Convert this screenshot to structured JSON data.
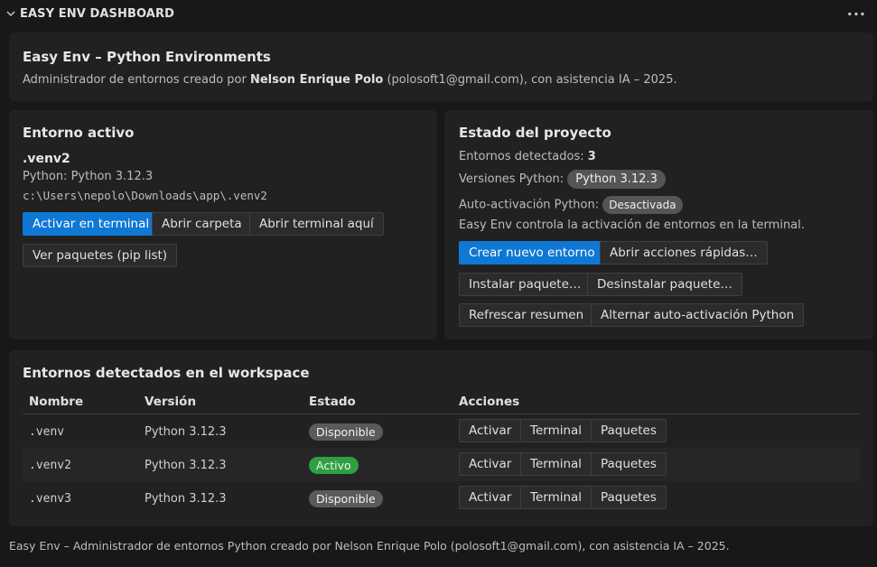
{
  "header": {
    "title": "EASY ENV DASHBOARD"
  },
  "intro": {
    "title": "Easy Env – Python Environments",
    "desc_prefix": "Administrador de entornos creado por ",
    "author": "Nelson Enrique Polo",
    "desc_suffix": " (polosoft1@gmail.com), con asistencia IA – 2025."
  },
  "active_env": {
    "heading": "Entorno activo",
    "name": ".venv2",
    "python": "Python: Python 3.12.3",
    "path": "c:\\Users\\nepolo\\Downloads\\app\\.venv2",
    "buttons": {
      "activate": "Activar en terminal",
      "open_folder": "Abrir carpeta",
      "open_terminal": "Abrir terminal aquí",
      "packages": "Ver paquetes (pip list)"
    }
  },
  "project": {
    "heading": "Estado del proyecto",
    "detected_label": "Entornos detectados: ",
    "detected_count": "3",
    "versions_label": "Versiones Python:",
    "version_pill": "Python 3.12.3",
    "autoact_label": "Auto-activación Python:",
    "autoact_state": "Desactivada",
    "note": "Easy Env controla la activación de entornos en la terminal.",
    "buttons": {
      "create": "Crear nuevo entorno",
      "quick": "Abrir acciones rápidas…",
      "install": "Instalar paquete…",
      "uninstall": "Desinstalar paquete…",
      "refresh": "Refrescar resumen",
      "toggle": "Alternar auto-activación Python"
    }
  },
  "workspace": {
    "heading": "Entornos detectados en el workspace",
    "columns": [
      "Nombre",
      "Versión",
      "Estado",
      "Acciones"
    ],
    "rows": [
      {
        "name": ".venv",
        "version": "Python 3.12.3",
        "status": "Disponible"
      },
      {
        "name": ".venv2",
        "version": "Python 3.12.3",
        "status": "Activo"
      },
      {
        "name": ".venv3",
        "version": "Python 3.12.3",
        "status": "Disponible"
      }
    ],
    "actions": [
      "Activar",
      "Terminal",
      "Paquetes"
    ]
  },
  "colors": {
    "accent": "#0e78d4",
    "active_badge": "#2ea043",
    "neutral_badge": "#5a5a5a"
  },
  "footer": "Easy Env – Administrador de entornos Python creado por Nelson Enrique Polo (polosoft1@gmail.com), con asistencia IA – 2025."
}
